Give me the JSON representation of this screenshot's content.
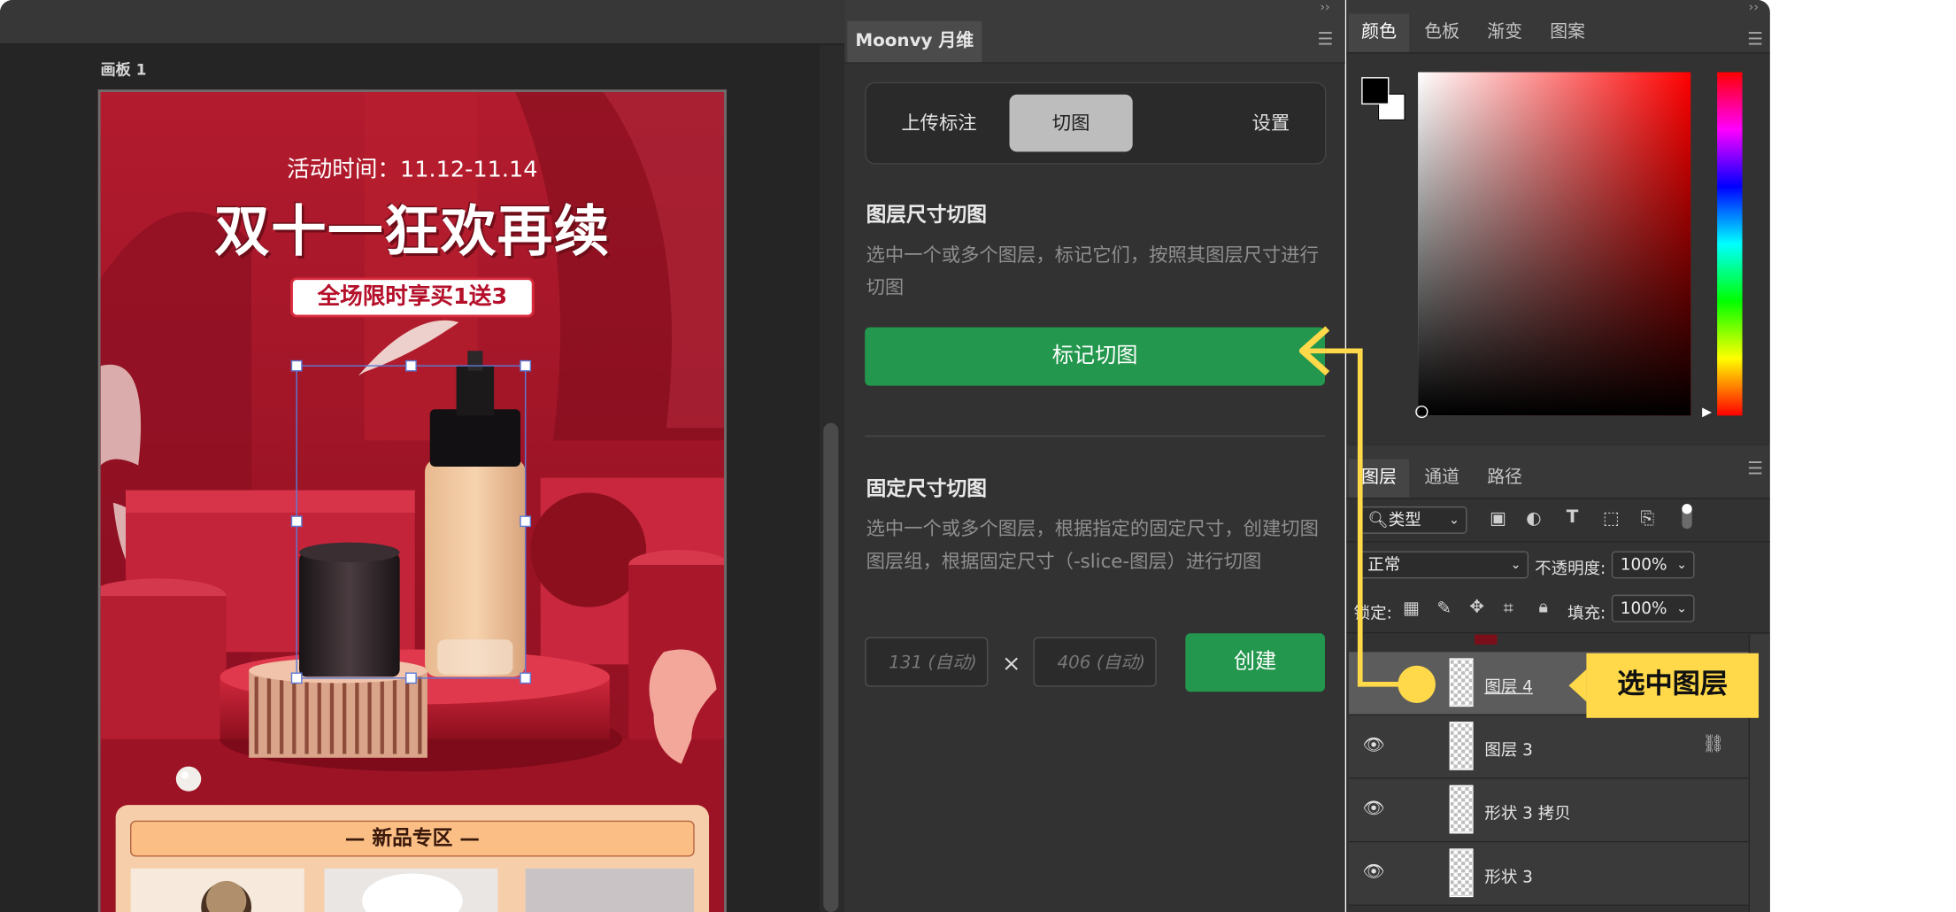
{
  "canvas": {
    "artboard_label": "画板 1",
    "poster": {
      "activity_time": "活动时间：11.12-11.14",
      "headline": "双十一狂欢再续",
      "promo_badge": "全场限时享买1送3",
      "section_title": "— 新品专区 —"
    }
  },
  "moonvy": {
    "panel_tab": "Moonvy 月维",
    "segments": [
      "上传标注",
      "切图",
      "设置"
    ],
    "active_segment": "切图",
    "layer_size_title": "图层尺寸切图",
    "layer_size_desc": "选中一个或多个图层，标记它们，按照其图层尺寸进行切图",
    "mark_button": "标记切图",
    "fixed_size_title": "固定尺寸切图",
    "fixed_size_desc": "选中一个或多个图层，根据指定的固定尺寸，创建切图图层组，根据固定尺寸（-slice-图层）进行切图",
    "width_placeholder": "131 (自动)",
    "height_placeholder": "406 (自动)",
    "times_symbol": "×",
    "create_button": "创建"
  },
  "color_panel": {
    "tabs": [
      "颜色",
      "色板",
      "渐变",
      "图案"
    ],
    "active_tab": "颜色",
    "foreground": "#000000",
    "background": "#ffffff"
  },
  "layers_panel": {
    "tabs": [
      "图层",
      "通道",
      "路径"
    ],
    "active_tab": "图层",
    "filter_label": "类型",
    "blend_mode": "正常",
    "opacity_label": "不透明度:",
    "opacity": "100%",
    "lock_label": "锁定:",
    "fill_label": "填充:",
    "fill": "100%",
    "layers": [
      {
        "name": "图层 4",
        "selected": true,
        "linked": false
      },
      {
        "name": "图层 3",
        "selected": false,
        "linked": true
      },
      {
        "name": "形状 3 拷贝",
        "selected": false,
        "linked": false
      },
      {
        "name": "形状 3",
        "selected": false,
        "linked": false
      }
    ]
  },
  "annotation": {
    "callout_text": "选中图层",
    "accent_color": "#ffd94a"
  },
  "colors": {
    "primary_green": "#23974d",
    "poster_red": "#a8172a"
  }
}
